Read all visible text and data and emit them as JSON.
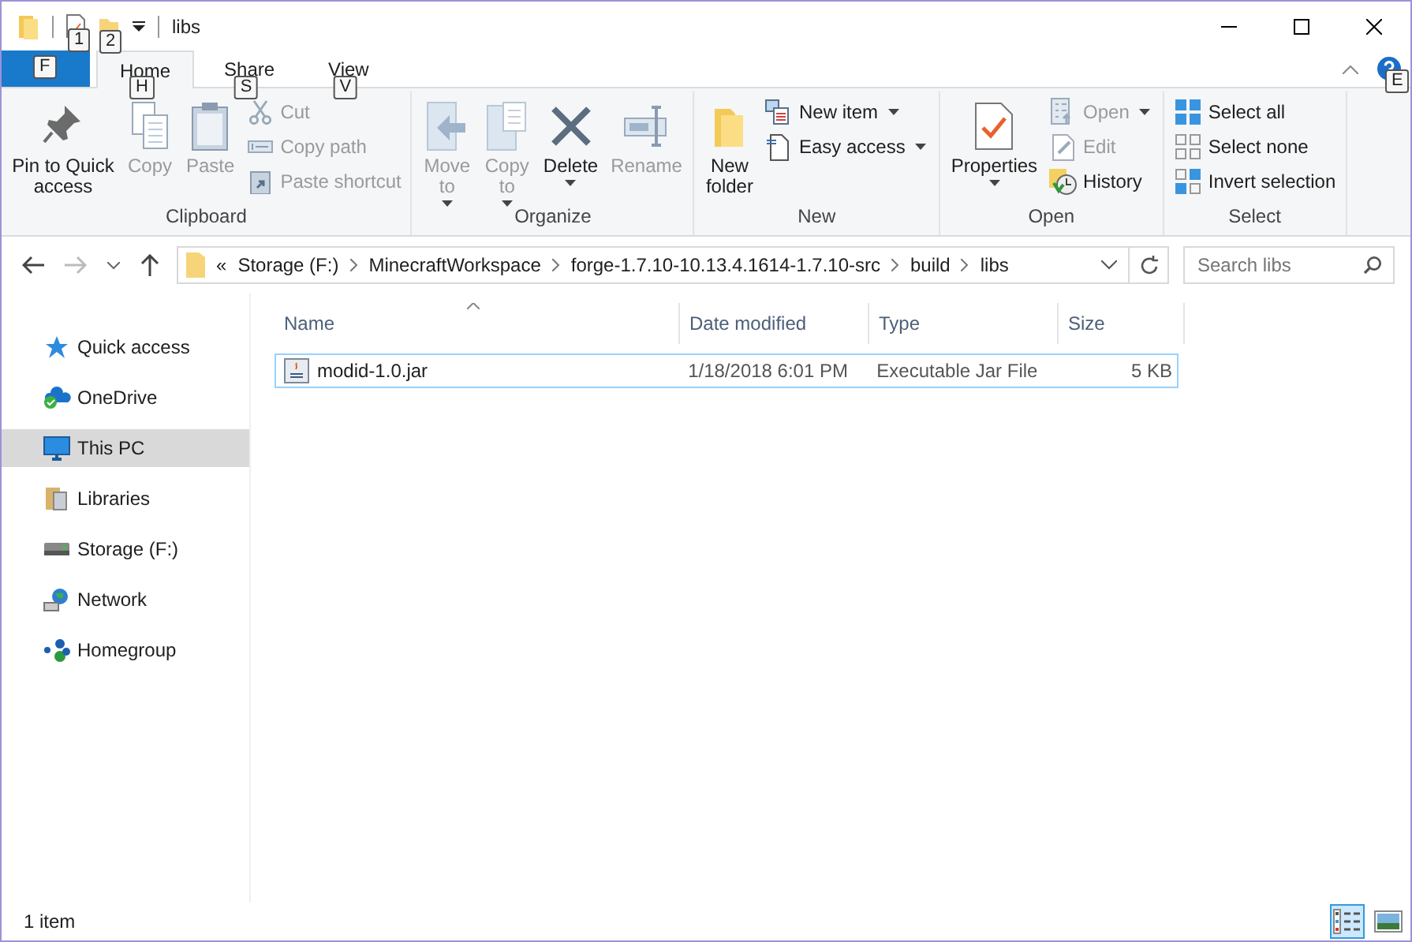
{
  "window": {
    "title": "libs",
    "quick_access_keytips": [
      "1",
      "2"
    ]
  },
  "ribbon_tabs": [
    {
      "keytip": "F",
      "kind": "file",
      "selected": false
    },
    {
      "label": "Home",
      "keytip": "H",
      "kind": "tab",
      "selected": true
    },
    {
      "label": "Share",
      "keytip": "S",
      "kind": "tab",
      "selected": false
    },
    {
      "label": "View",
      "keytip": "V",
      "kind": "tab",
      "selected": false
    }
  ],
  "help_keytip": "E",
  "ribbon_groups": [
    {
      "label": "Clipboard",
      "commands": [
        {
          "label_lines": [
            "Pin to Quick",
            "access"
          ],
          "kind": "large",
          "disabled": false,
          "dropdown": false
        },
        {
          "label_lines": [
            "Copy"
          ],
          "kind": "large",
          "disabled": true,
          "dropdown": false
        },
        {
          "label_lines": [
            "Paste"
          ],
          "kind": "large",
          "disabled": true,
          "dropdown": false
        },
        {
          "label_lines": [
            "Cut"
          ],
          "kind": "small",
          "disabled": true,
          "dropdown": false
        },
        {
          "label_lines": [
            "Copy path"
          ],
          "kind": "small",
          "disabled": true,
          "dropdown": false
        },
        {
          "label_lines": [
            "Paste shortcut"
          ],
          "kind": "small",
          "disabled": true,
          "dropdown": false
        }
      ]
    },
    {
      "label": "Organize",
      "commands": [
        {
          "label_lines": [
            "Move",
            "to"
          ],
          "kind": "large",
          "disabled": true,
          "dropdown": true
        },
        {
          "label_lines": [
            "Copy",
            "to"
          ],
          "kind": "large",
          "disabled": true,
          "dropdown": true
        },
        {
          "label_lines": [
            "Delete"
          ],
          "kind": "large",
          "disabled": false,
          "dropdown": true
        },
        {
          "label_lines": [
            "Rename"
          ],
          "kind": "large",
          "disabled": true,
          "dropdown": false
        }
      ]
    },
    {
      "label": "New",
      "commands": [
        {
          "label_lines": [
            "New",
            "folder"
          ],
          "kind": "large",
          "disabled": false,
          "dropdown": false
        },
        {
          "label_lines": [
            "New item"
          ],
          "kind": "small",
          "disabled": false,
          "dropdown": true
        },
        {
          "label_lines": [
            "Easy access"
          ],
          "kind": "small",
          "disabled": false,
          "dropdown": true
        }
      ]
    },
    {
      "label": "Open",
      "commands": [
        {
          "label_lines": [
            "Properties"
          ],
          "kind": "large",
          "disabled": false,
          "dropdown": true
        },
        {
          "label_lines": [
            "Open"
          ],
          "kind": "small",
          "disabled": true,
          "dropdown": true
        },
        {
          "label_lines": [
            "Edit"
          ],
          "kind": "small",
          "disabled": true,
          "dropdown": false
        },
        {
          "label_lines": [
            "History"
          ],
          "kind": "small",
          "disabled": false,
          "dropdown": false
        }
      ]
    },
    {
      "label": "Select",
      "commands": [
        {
          "label_lines": [
            "Select all"
          ],
          "kind": "small",
          "disabled": false,
          "dropdown": false
        },
        {
          "label_lines": [
            "Select none"
          ],
          "kind": "small",
          "disabled": false,
          "dropdown": false
        },
        {
          "label_lines": [
            "Invert selection"
          ],
          "kind": "small",
          "disabled": false,
          "dropdown": false
        }
      ]
    }
  ],
  "address_bar": {
    "overflow": "«",
    "path": [
      "Storage (F:)",
      "MinecraftWorkspace",
      "forge-1.7.10-10.13.4.1614-1.7.10-src",
      "build",
      "libs"
    ]
  },
  "search": {
    "placeholder": "Search libs"
  },
  "navigation_pane": [
    {
      "label": "Quick access",
      "selected": false
    },
    {
      "label": "OneDrive",
      "selected": false
    },
    {
      "label": "This PC",
      "selected": true
    },
    {
      "label": "Libraries",
      "selected": false
    },
    {
      "label": "Storage (F:)",
      "selected": false
    },
    {
      "label": "Network",
      "selected": false
    },
    {
      "label": "Homegroup",
      "selected": false
    }
  ],
  "file_list": {
    "columns": [
      "Name",
      "Date modified",
      "Type",
      "Size"
    ],
    "rows": [
      {
        "name": "modid-1.0.jar",
        "date_modified": "1/18/2018 6:01 PM",
        "type": "Executable Jar File",
        "size": "5 KB",
        "focused": true
      }
    ]
  },
  "status_bar": {
    "text": "1 item",
    "views": [
      {
        "kind": "details",
        "selected": true
      },
      {
        "kind": "large_icons",
        "selected": false
      }
    ]
  }
}
